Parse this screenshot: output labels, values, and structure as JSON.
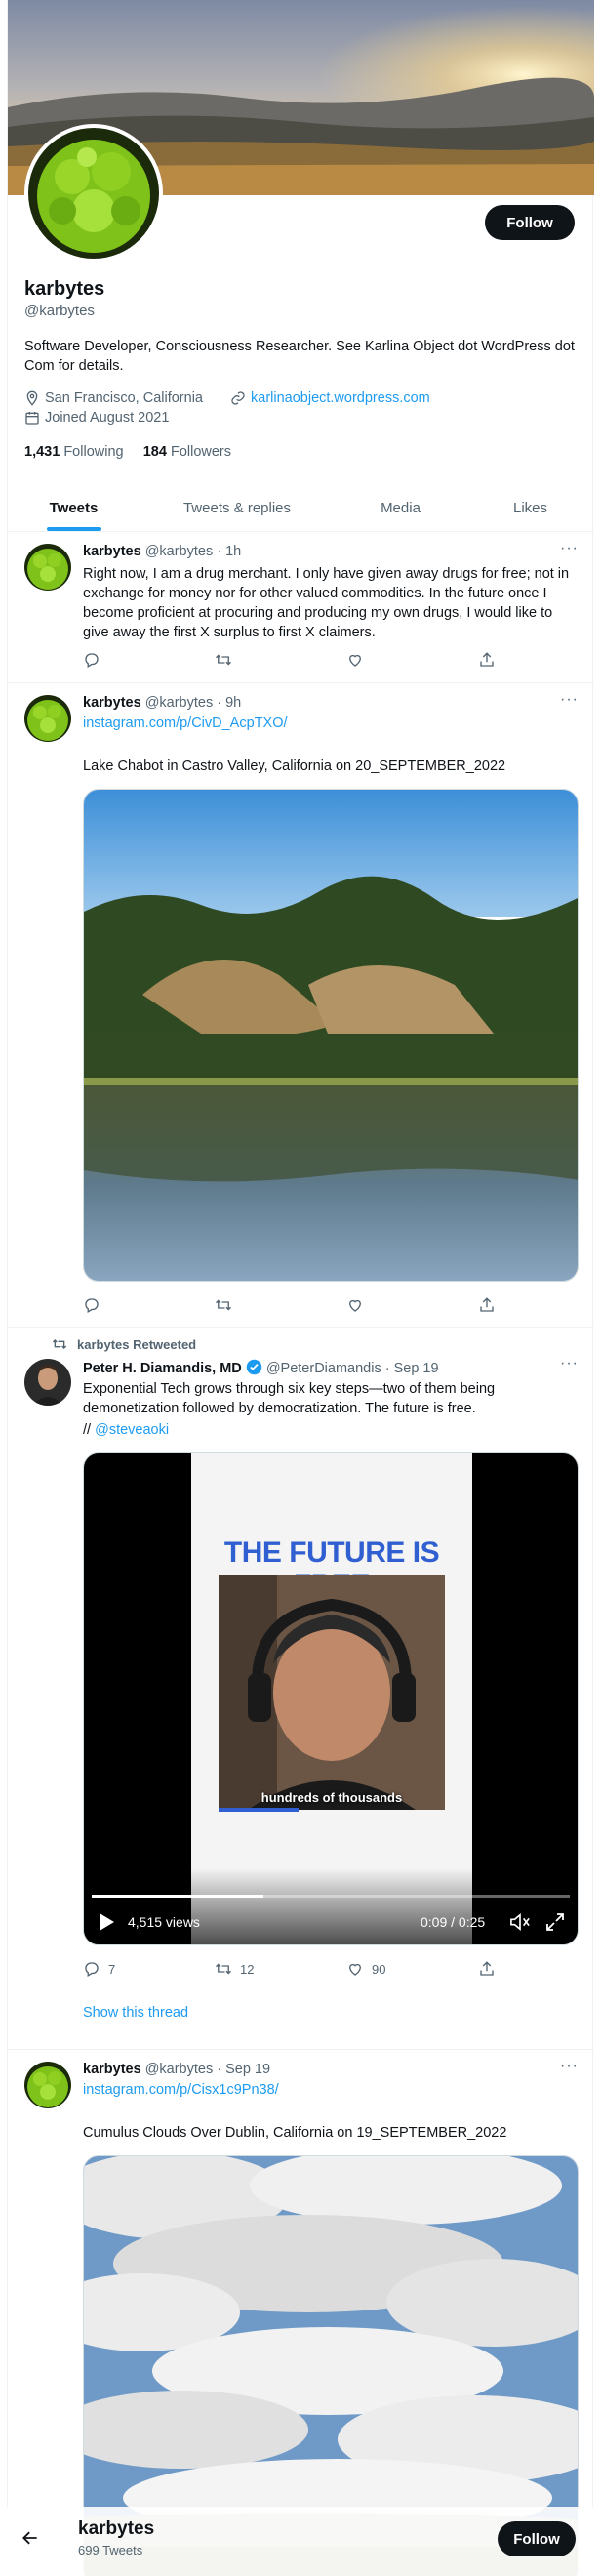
{
  "profile": {
    "name": "karbytes",
    "handle": "@karbytes",
    "bio": "Software Developer, Consciousness Researcher. See Karlina Object dot WordPress dot Com for details.",
    "location": "San Francisco, California",
    "website": "karlinaobject.wordpress.com",
    "joined": "Joined August 2021",
    "following_count": "1,431",
    "following_label": "Following",
    "followers_count": "184",
    "followers_label": "Followers",
    "follow_label": "Follow"
  },
  "tabs": [
    {
      "label": "Tweets",
      "active": true
    },
    {
      "label": "Tweets & replies",
      "active": false
    },
    {
      "label": "Media",
      "active": false
    },
    {
      "label": "Likes",
      "active": false
    }
  ],
  "tweets": [
    {
      "name": "karbytes",
      "handle": "@karbytes",
      "time": "· 1h",
      "text": "Right now, I am a drug merchant. I only have given away drugs for free; not in exchange for money nor for other valued commodities. In the future once I become proficient at procuring and producing my own drugs, I would like to give away the first X surplus to first X claimers."
    },
    {
      "name": "karbytes",
      "handle": "@karbytes",
      "time": "· 9h",
      "link": "instagram.com/p/CivD_AcpTXO/",
      "text": "Lake Chabot in Castro Valley, California on 20_SEPTEMBER_2022"
    },
    {
      "retweet_label": "karbytes Retweeted",
      "name": "Peter H. Diamandis, MD",
      "handle": "@PeterDiamandis",
      "time": "· Sep 19",
      "text": "Exponential Tech grows through six key steps—two of them being demonetization followed by democratization. The future is free.",
      "mention_prefix": "//",
      "mention": "@steveaoki",
      "video_headline": "THE FUTURE IS FREE",
      "video_caption": "hundreds of thousands",
      "views": "4,515 views",
      "video_time": "0:09 / 0:25",
      "reply_count": "7",
      "retweet_count": "12",
      "like_count": "90",
      "show_thread": "Show this thread"
    },
    {
      "name": "karbytes",
      "handle": "@karbytes",
      "time": "· Sep 19",
      "link": "instagram.com/p/Cisx1c9Pn38/",
      "text": "Cumulus Clouds Over Dublin, California on 19_SEPTEMBER_2022"
    }
  ],
  "bottom_bar": {
    "name": "karbytes",
    "tweet_count": "699 Tweets",
    "follow_label": "Follow"
  },
  "colors": {
    "accent": "#1d9bf0",
    "text": "#0f1419",
    "muted": "#536471",
    "button": "#0f1419"
  },
  "icons": [
    "location-icon",
    "link-icon",
    "calendar-icon",
    "reply-icon",
    "retweet-icon",
    "like-icon",
    "share-icon",
    "more-icon",
    "verified-icon",
    "play-icon",
    "mute-icon",
    "fullscreen-icon",
    "back-arrow-icon"
  ]
}
